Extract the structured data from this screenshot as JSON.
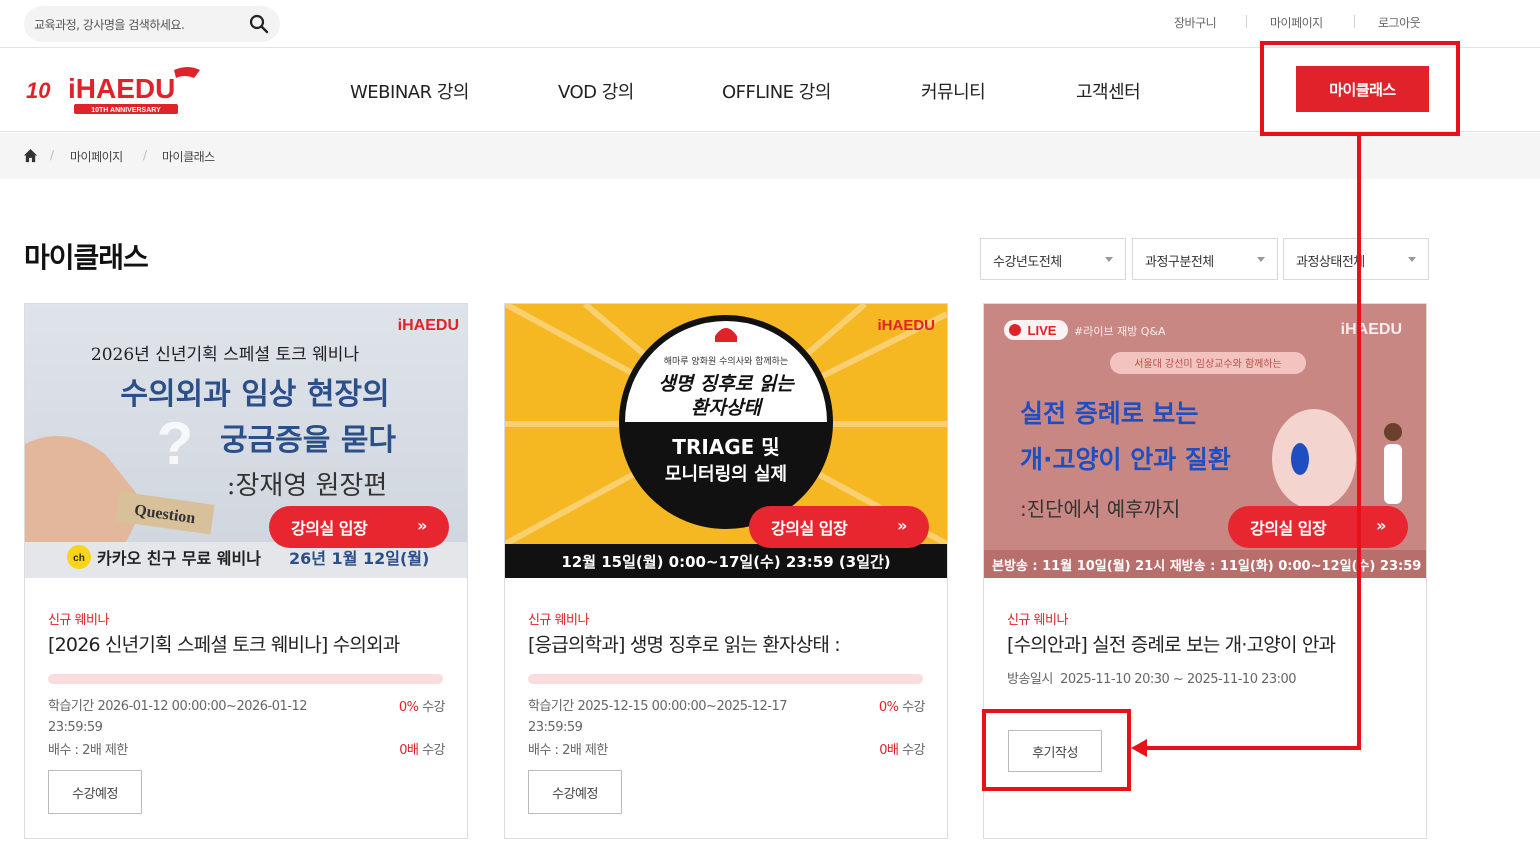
{
  "search": {
    "placeholder": "교육과정, 강사명을 검색하세요."
  },
  "util_links": [
    "장바구니",
    "마이페이지",
    "로그아웃"
  ],
  "logo": {
    "text": "iHAEDU",
    "sub": "10TH ANNIVERSARY"
  },
  "nav": [
    "WEBINAR 강의",
    "VOD 강의",
    "OFFLINE 강의",
    "커뮤니티",
    "고객센터"
  ],
  "myclass_button": "마이클래스",
  "breadcrumb": [
    "마이페이지",
    "마이클래스"
  ],
  "page_title": "마이클래스",
  "filters": [
    "수강년도전체",
    "과정구분전체",
    "과정상태전체"
  ],
  "enter_label": "강의실 입장",
  "cards": [
    {
      "category": "신규 웨비나",
      "title": "[2026 신년기획 스페셜 토크 웨비나] 수의외과",
      "progress": 0,
      "period_label": "학습기간",
      "period": "2026-01-12 00:00:00~2026-01-12 23:59:59",
      "percent": "0%",
      "percent_suffix": "수강",
      "limit": "배수 : 2배 제한",
      "times": "0배",
      "times_suffix": "수강",
      "button": "수강예정",
      "banner": {
        "brand": "iHAEDU",
        "line1": "2026년 신년기획 스페셜 토크 웨비나",
        "line2": "수의외과 임상 현장의",
        "line3": "궁금증을 묻다",
        "line4": ":장재영 원장편",
        "tag": "Question",
        "footer_a": "카카오 친구 무료 웨비나",
        "footer_b": "26년 1월 12일(월)"
      }
    },
    {
      "category": "신규 웨비나",
      "title": "[응급의학과] 생명 징후로 읽는 환자상태 :",
      "progress": 0,
      "period_label": "학습기간",
      "period": "2025-12-15 00:00:00~2025-12-17 23:59:59",
      "percent": "0%",
      "percent_suffix": "수강",
      "limit": "배수 : 2배 제한",
      "times": "0배",
      "times_suffix": "수강",
      "button": "수강예정",
      "banner": {
        "brand": "iHAEDU",
        "small": "해마루 양화원 수의사와 함께하는",
        "line1": "생명 징후로 읽는",
        "line2": "환자상태",
        "line3": "TRIAGE 및",
        "line4": "모니터링의 실제",
        "footer": "12월 15일(월) 0:00~17일(수) 23:59 (3일간)"
      }
    },
    {
      "category": "신규 웨비나",
      "title": "[수의안과] 실전 증례로 보는 개·고양이 안과",
      "broadcast_label": "방송일시",
      "broadcast": "2025-11-10 20:30 ~ 2025-11-10 23:00",
      "button": "후기작성",
      "banner": {
        "brand": "iHAEDU",
        "live": "LIVE",
        "live_sub": "#라이브 재방 Q&A",
        "small": "서울대 강선미 임상교수와 함께하는",
        "line1": "실전 증례로 보는",
        "line2": "개·고양이 안과 질환",
        "line3": ":진단에서 예후까지",
        "footer": "본방송 : 11월 10일(월) 21시  재방송 : 11일(화) 0:00~12일(수) 23:59"
      }
    }
  ],
  "colors": {
    "brand_red": "#e0222b",
    "annotation_red": "#e8101b"
  }
}
